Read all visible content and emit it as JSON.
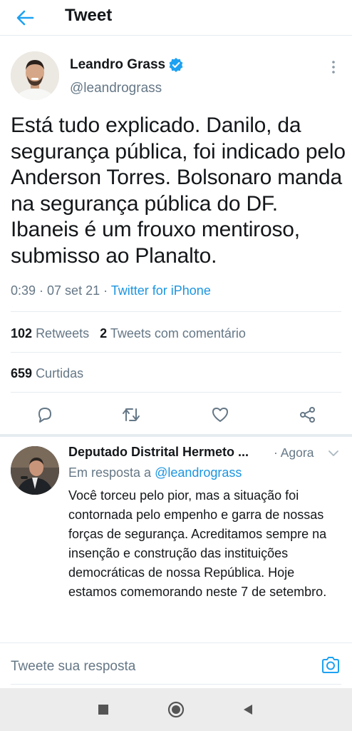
{
  "header": {
    "title": "Tweet"
  },
  "tweet": {
    "author_name": "Leandro Grass",
    "author_handle": "@leandrograss",
    "text": "Está tudo explicado. Danilo, da segurança pública, foi indicado pelo Anderson Torres. Bolsonaro manda na segurança pública do DF. Ibaneis é um frouxo mentiroso, submisso ao Planalto.",
    "time": "0:39 · 07 set 21 · ",
    "source": "Twitter for iPhone",
    "retweets_count": "102",
    "retweets_label": "Retweets",
    "quotes_count": "2",
    "quotes_label": "Tweets com comentário",
    "likes_count": "659",
    "likes_label": "Curtidas"
  },
  "reply": {
    "author_name": "Deputado Distrital Hermeto ...",
    "time": "· Agora",
    "in_reply_prefix": "Em resposta a ",
    "in_reply_mention": "@leandrograss",
    "text": "Você torceu pelo pior, mas a situação foi contornada pelo empenho e garra de nossas forças de segurança. Acreditamos sempre na insenção e construção das instituições democráticas de nossa República. Hoje estamos comemorando neste 7 de setembro."
  },
  "compose": {
    "placeholder": "Tweete sua resposta"
  },
  "colors": {
    "accent": "#1da1f2",
    "link": "#1b95e0",
    "muted": "#657786",
    "text": "#14171a"
  },
  "icons": [
    "back-arrow-icon",
    "verified-badge-icon",
    "more-vertical-icon",
    "reply-icon",
    "retweet-icon",
    "like-icon",
    "share-icon",
    "chevron-down-icon",
    "camera-icon",
    "nav-square-icon",
    "nav-home-icon",
    "nav-back-icon"
  ]
}
